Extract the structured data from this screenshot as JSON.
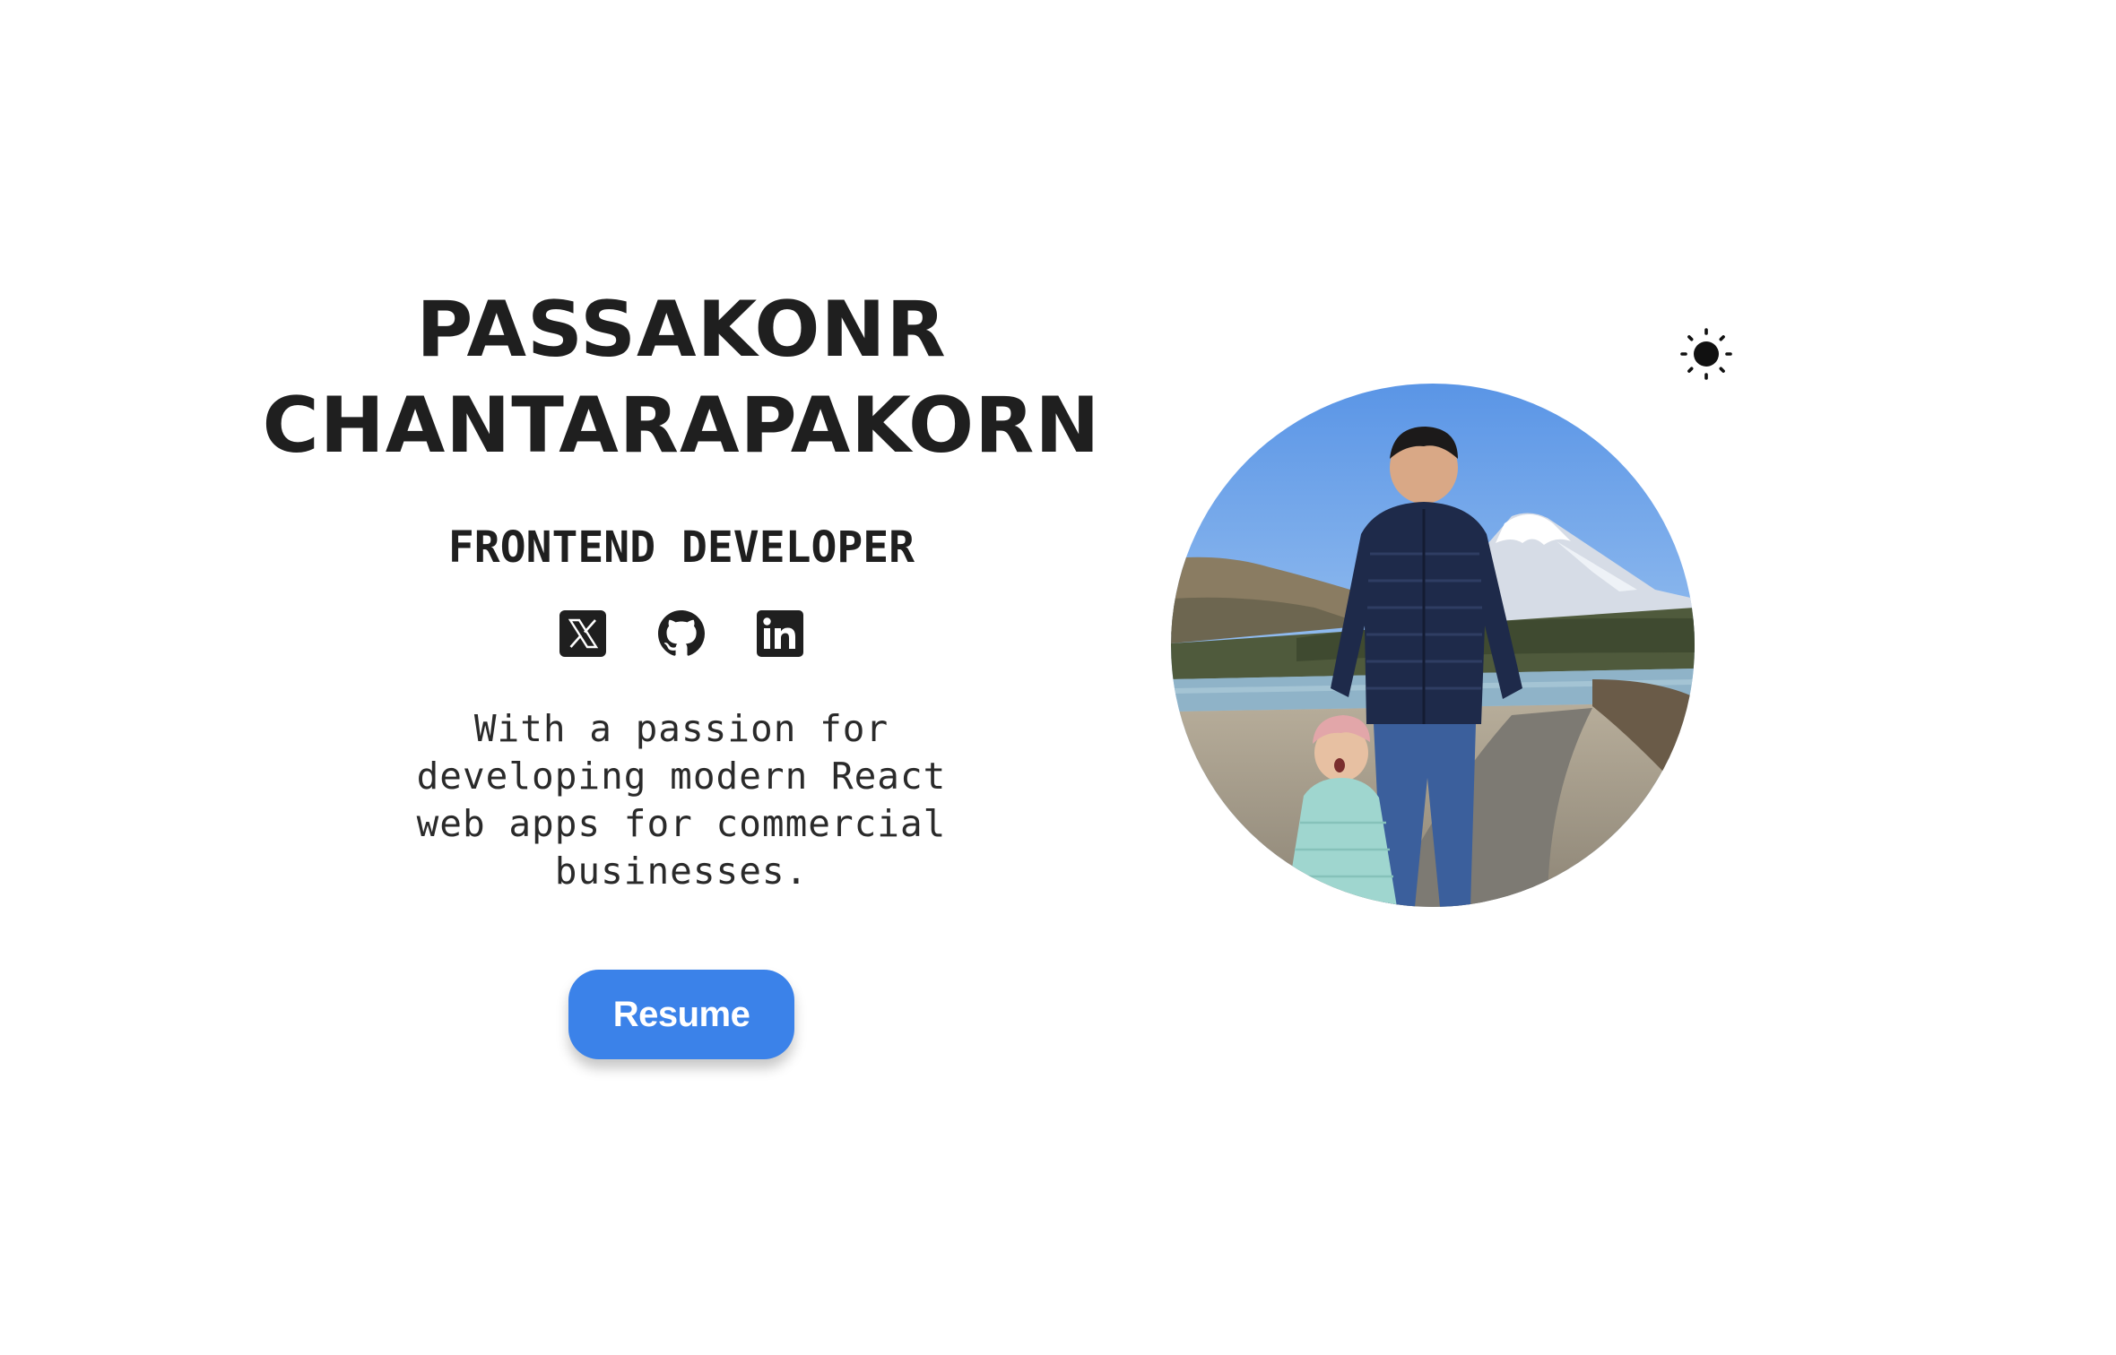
{
  "profile": {
    "name_line1": "PASSAKONR",
    "name_line2": "CHANTARAPAKORN",
    "role": "FRONTEND DEVELOPER",
    "bio": "With a passion for developing modern React web apps for commercial businesses.",
    "resume_label": "Resume"
  },
  "socials": [
    {
      "icon": "x-twitter-icon"
    },
    {
      "icon": "github-icon"
    },
    {
      "icon": "linkedin-icon"
    }
  ],
  "theme_toggle": {
    "icon": "sun-icon"
  },
  "photo": {
    "subject": "profile-photo"
  },
  "colors": {
    "text": "#1f1f1f",
    "accent": "#3b82e9",
    "background": "#ffffff"
  }
}
